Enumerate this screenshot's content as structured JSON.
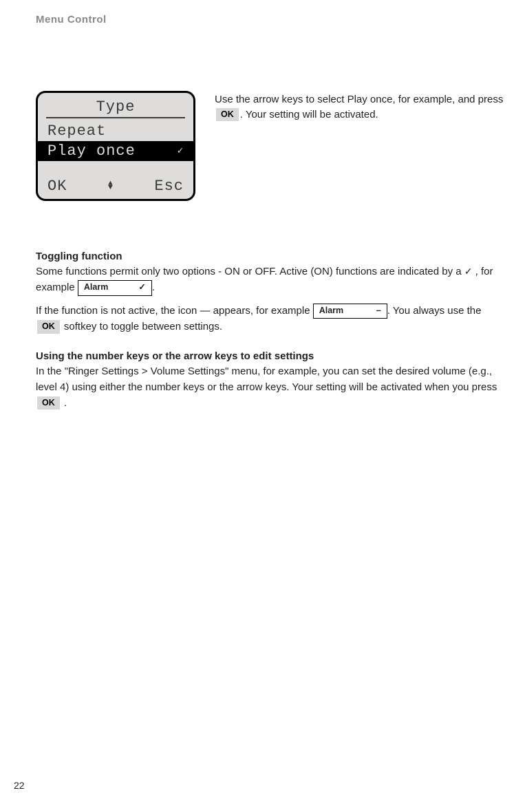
{
  "header": {
    "title": "Menu Control"
  },
  "lcd": {
    "title": "Type",
    "items": [
      {
        "label": "Repeat",
        "selected": false,
        "checked": false
      },
      {
        "label": "Play once",
        "selected": true,
        "checked": true
      }
    ],
    "soft_left": "OK",
    "soft_right": "Esc"
  },
  "side": {
    "line1_a": "Use the arrow keys to select Play once, for example, and press ",
    "ok_key": "OK",
    "line1_b": ". Your setting will be activated."
  },
  "toggling": {
    "heading": "Toggling function",
    "p1_a": "Some functions permit only two options - ON or OFF. Active (ON) functions are indicated by a ",
    "check": "✓",
    "p1_b": ", for example ",
    "alarm_on_label": "Alarm",
    "alarm_on_state": "✓",
    "p1_c": ".",
    "p2_a": "If the function is not active, the icon — appears, for example ",
    "alarm_off_label": "Alarm",
    "alarm_off_state": "–",
    "p2_b": ". You always use the ",
    "ok_key": "OK",
    "p2_c": " softkey to toggle between settings."
  },
  "numberkeys": {
    "heading": "Using the number keys or the arrow keys to edit settings",
    "p_a": "In the \"Ringer Settings > Volume Settings\" menu, for example, you can set the desired volume (e.g., level 4) using either the number keys or the arrow keys. Your setting will be activated when you press ",
    "ok_key": "OK",
    "p_b": " ."
  },
  "page_number": "22"
}
